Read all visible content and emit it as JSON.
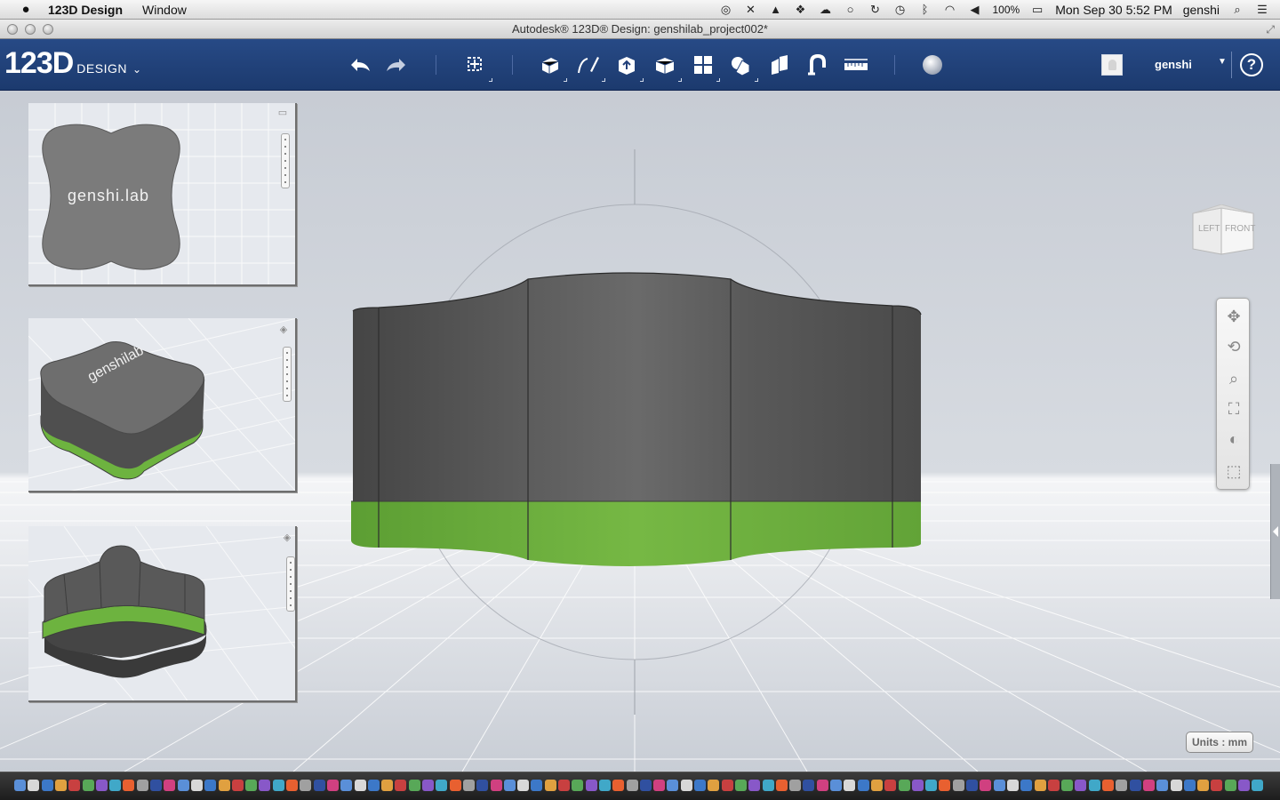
{
  "menubar": {
    "app_name": "123D Design",
    "menus": [
      "Window"
    ],
    "battery": "100%",
    "datetime": "Mon Sep 30  5:52 PM",
    "user": "genshi"
  },
  "window": {
    "title": "Autodesk® 123D® Design: genshilab_project002*"
  },
  "toolbar": {
    "logo_number": "123D",
    "logo_word": "DESIGN",
    "user_name": "genshi",
    "help_label": "?"
  },
  "thumbnails": {
    "top_label": "genshi.lab",
    "perspective_label": "genshilab"
  },
  "viewcube": {
    "left_face": "LEFT",
    "front_face": "FRONT"
  },
  "units_label": "Units : mm",
  "colors": {
    "toolbar_blue": "#21407a",
    "model_gray": "#5a5a5a",
    "model_green": "#6db33f",
    "viewport_bg": "#c9ced6"
  },
  "icons": {
    "toolbar": [
      "undo-icon",
      "redo-icon",
      "transform-icon",
      "primitives-icon",
      "sketch-icon",
      "construct-icon",
      "modify-icon",
      "pattern-icon",
      "grouping-icon",
      "combine-icon",
      "snap-icon",
      "measure-icon",
      "material-icon"
    ],
    "nav": [
      "pan-icon",
      "orbit-icon",
      "zoom-icon",
      "fit-icon",
      "visual-style-icon",
      "view-box-icon"
    ]
  }
}
